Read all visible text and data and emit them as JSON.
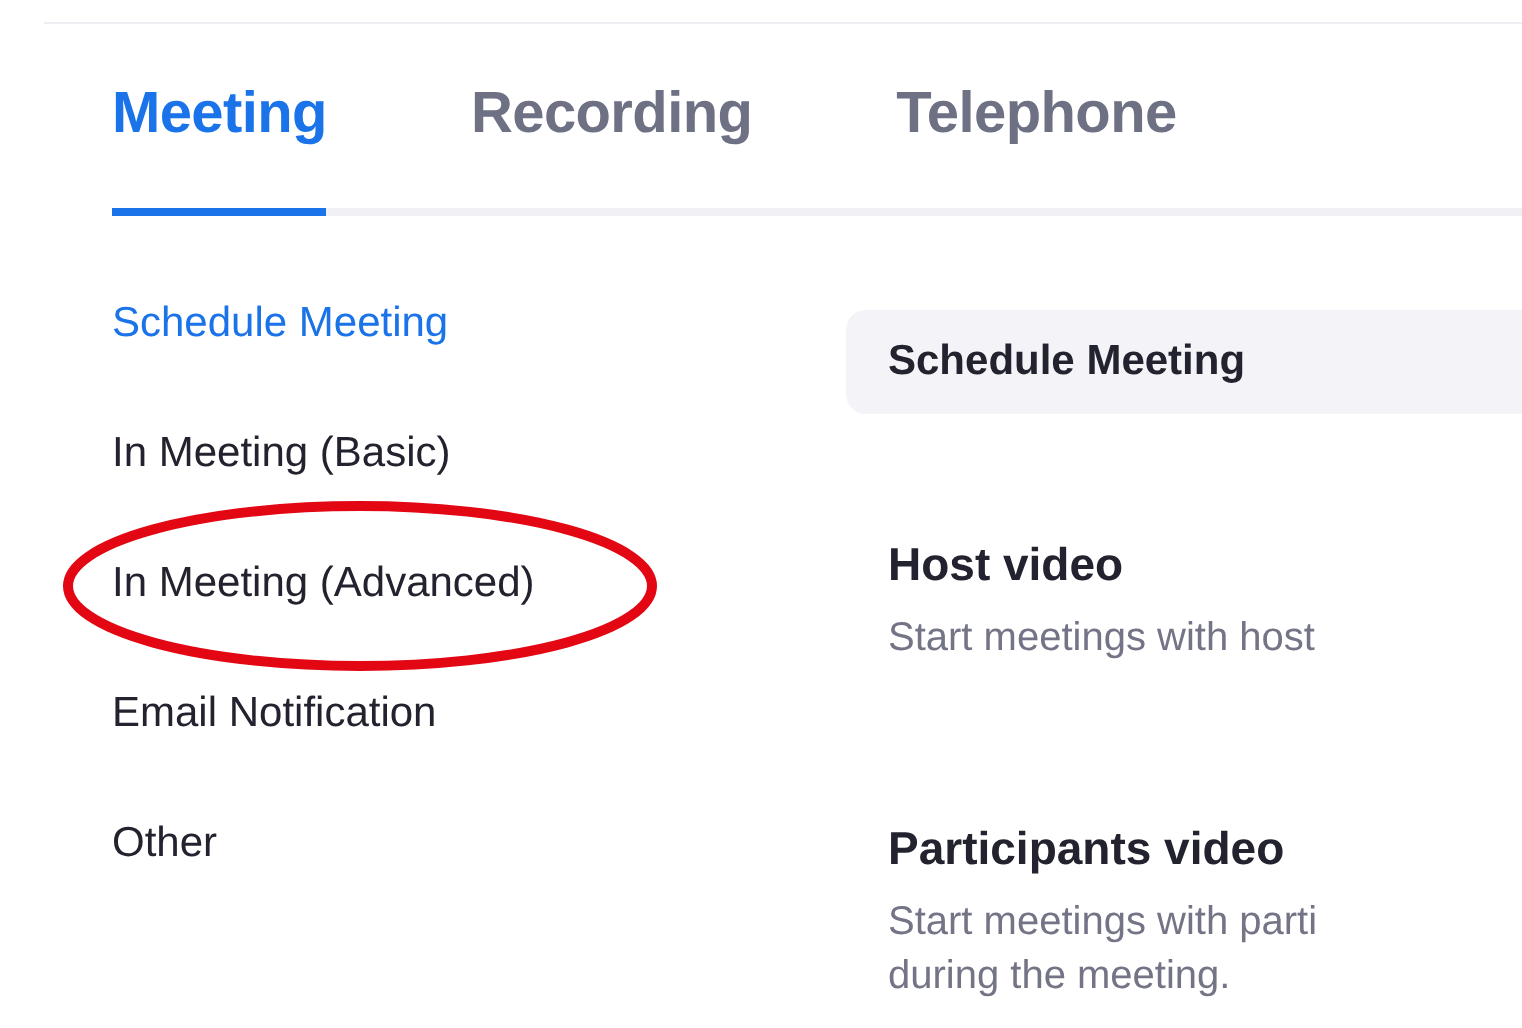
{
  "tabs": [
    {
      "label": "Meeting",
      "selected": true
    },
    {
      "label": "Recording",
      "selected": false
    },
    {
      "label": "Telephone",
      "selected": false
    }
  ],
  "sidebar": {
    "items": [
      {
        "label": "Schedule Meeting",
        "selected": true,
        "circled": false
      },
      {
        "label": "In Meeting (Basic)",
        "selected": false,
        "circled": false
      },
      {
        "label": "In Meeting (Advanced)",
        "selected": false,
        "circled": true
      },
      {
        "label": "Email Notification",
        "selected": false,
        "circled": false
      },
      {
        "label": "Other",
        "selected": false,
        "circled": false
      }
    ]
  },
  "section": {
    "title": "Schedule Meeting",
    "settings": [
      {
        "title": "Host video",
        "description": [
          "Start meetings with host"
        ]
      },
      {
        "title": "Participants video",
        "description": [
          "Start meetings with parti",
          "during the meeting."
        ]
      }
    ]
  }
}
